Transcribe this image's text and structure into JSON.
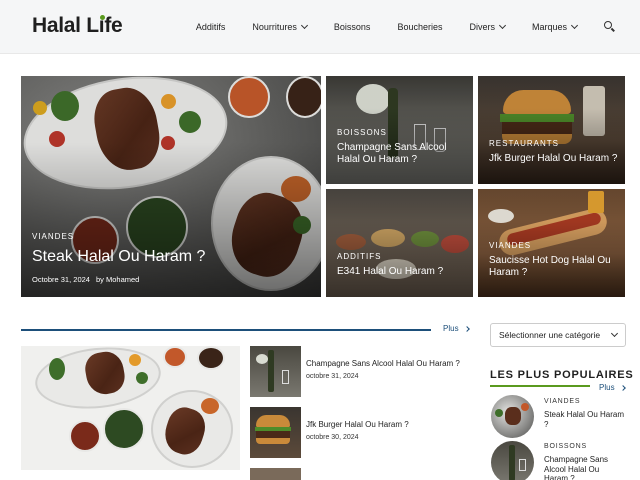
{
  "header": {
    "logo": "Halal Life",
    "nav": [
      {
        "label": "Additifs",
        "has_menu": false
      },
      {
        "label": "Nourritures",
        "has_menu": true
      },
      {
        "label": "Boissons",
        "has_menu": false
      },
      {
        "label": "Boucheries",
        "has_menu": false
      },
      {
        "label": "Divers",
        "has_menu": true
      },
      {
        "label": "Marques",
        "has_menu": true
      }
    ],
    "search_icon": "search-icon"
  },
  "hero": {
    "main": {
      "category": "VIANDES",
      "title": "Steak Halal Ou Haram ?",
      "date": "Octobre 31, 2024",
      "author": "by Mohamed"
    },
    "tiles": [
      {
        "category": "BOISSONS",
        "title": "Champagne Sans Alcool Halal Ou Haram ?"
      },
      {
        "category": "RESTAURANTS",
        "title": "Jfk Burger Halal Ou Haram ?"
      },
      {
        "category": "ADDITIFS",
        "title": "E341 Halal Ou Haram ?"
      },
      {
        "category": "VIANDES",
        "title": "Saucisse Hot Dog Halal Ou Haram ?"
      }
    ]
  },
  "section": {
    "more_label": "Plus",
    "list": [
      {
        "title": "Champagne Sans Alcool Halal Ou Haram ?",
        "date": "octobre 31, 2024"
      },
      {
        "title": "Jfk Burger Halal Ou Haram ?",
        "date": "octobre 30, 2024"
      }
    ]
  },
  "sidebar": {
    "category_select": "Sélectionner une catégorie",
    "popular_title": "LES PLUS POPULAIRES",
    "more_label": "Plus",
    "popular": [
      {
        "category": "VIANDES",
        "title": "Steak Halal Ou Haram ?"
      },
      {
        "category": "BOISSONS",
        "title": "Champagne Sans Alcool Halal Ou Haram ?"
      }
    ]
  },
  "colors": {
    "accent_blue": "#1d4f7a",
    "accent_green": "#5a9a1e",
    "header_bg": "#f5f6f7"
  }
}
